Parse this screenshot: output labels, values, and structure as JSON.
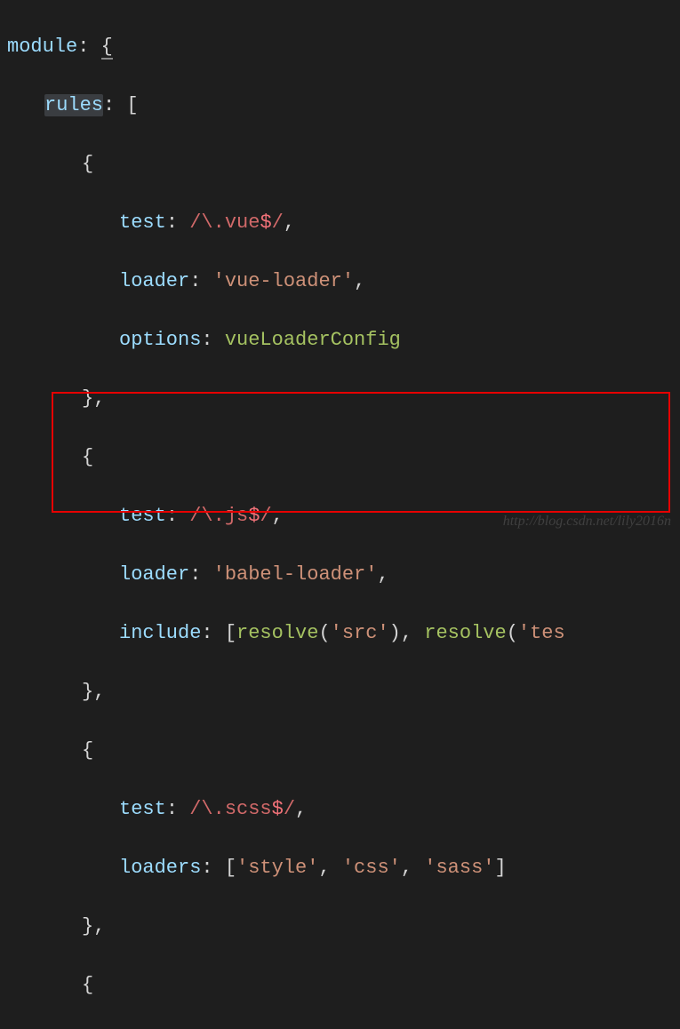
{
  "code": {
    "kw_module": "module",
    "kw_rules": "rules",
    "rule1": {
      "key_test": "test",
      "regex_open": "/",
      "regex_body": "\\.vue",
      "regex_dollar": "$",
      "regex_close": "/",
      "key_loader": "loader",
      "loader_val": "'vue-loader'",
      "key_options": "options",
      "options_val": "vueLoaderConfig"
    },
    "rule2": {
      "key_test": "test",
      "regex_open": "/",
      "regex_body": "\\.js",
      "regex_dollar": "$",
      "regex_close": "/",
      "key_loader": "loader",
      "loader_val": "'babel-loader'",
      "key_include": "include",
      "resolve_fn": "resolve",
      "resolve_arg1": "'src'",
      "resolve_arg2": "'tes"
    },
    "rule3": {
      "key_test": "test",
      "regex_open": "/",
      "regex_body": "\\.scss",
      "regex_dollar": "$",
      "regex_close": "/",
      "key_loaders": "loaders",
      "arr_v1": "'style'",
      "arr_v2": "'css'",
      "arr_v3": "'sass'"
    }
  },
  "watermark": "http://blog.csdn.net/lily2016n"
}
